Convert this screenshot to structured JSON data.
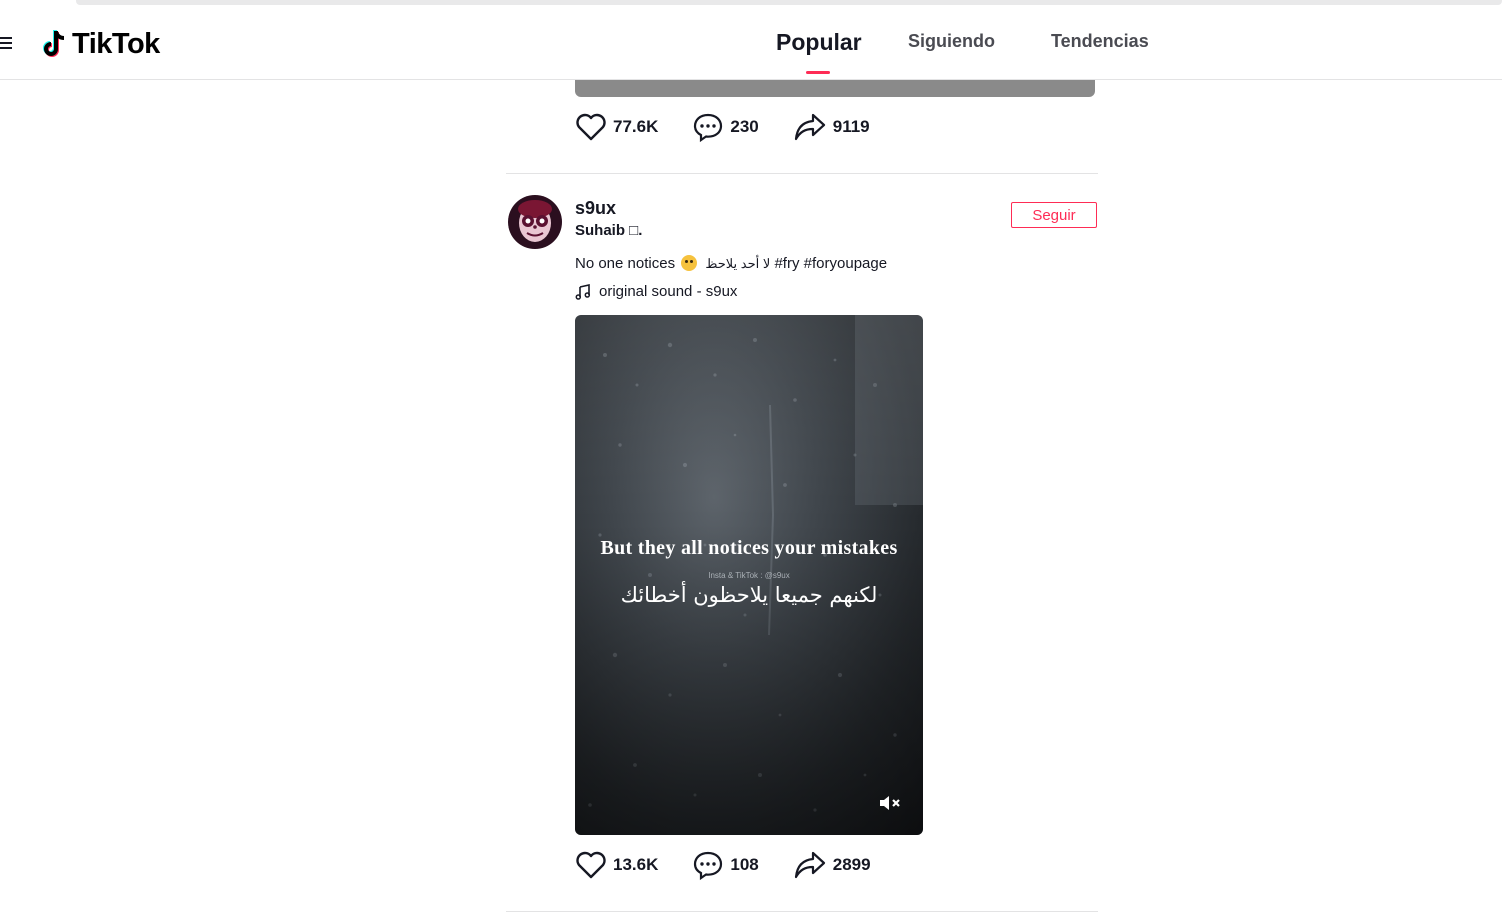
{
  "app": {
    "logo_text": "TikTok"
  },
  "nav": {
    "tabs": [
      {
        "label": "Popular",
        "active": true
      },
      {
        "label": "Siguiendo",
        "active": false
      },
      {
        "label": "Tendencias",
        "active": false
      }
    ],
    "accent_color": "#fe2c55"
  },
  "previous_post": {
    "likes": "77.6K",
    "comments": "230",
    "shares": "9119"
  },
  "post": {
    "username": "s9ux",
    "nickname": "Suhaib □.",
    "follow_label": "Seguir",
    "caption_text": "No one notices",
    "caption_arabic": "لا أحد يلاحظ",
    "hashtags": [
      "#fry",
      "#foryoupage"
    ],
    "music": "original sound - s9ux",
    "video": {
      "text_en": "But they all notices your mistakes",
      "credit": "Insta & TikTok : @s9ux",
      "text_ar": "لكنهم جميعا يلاحظون أخطائك",
      "muted": true
    },
    "likes": "13.6K",
    "comments": "108",
    "shares": "2899"
  },
  "icons": [
    "menu-icon",
    "tiktok-logo-icon",
    "heart-icon",
    "comment-icon",
    "share-icon",
    "music-note-icon",
    "mute-icon"
  ]
}
